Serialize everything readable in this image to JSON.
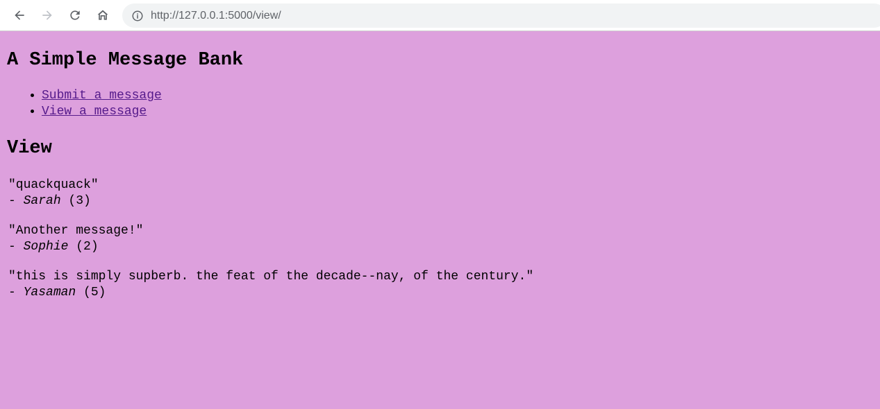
{
  "browser": {
    "url_host": "http://127.0.0.1",
    "url_rest": ":5000/view/"
  },
  "page": {
    "title": "A Simple Message Bank",
    "nav_links": [
      {
        "label": "Submit a message"
      },
      {
        "label": "View a message"
      }
    ],
    "section_heading": "View",
    "messages": [
      {
        "text": "\"quackquack\"",
        "prefix": "- ",
        "author": "Sarah",
        "count": " (3)"
      },
      {
        "text": "\"Another message!\"",
        "prefix": "- ",
        "author": "Sophie",
        "count": " (2)"
      },
      {
        "text": "\"this is simply supberb. the feat of the decade--nay, of the century.\"",
        "prefix": "- ",
        "author": "Yasaman",
        "count": " (5)"
      }
    ]
  },
  "colors": {
    "background": "#dda0dd",
    "link": "#551a8b"
  },
  "icons": [
    "back-arrow-icon",
    "forward-arrow-icon",
    "reload-icon",
    "home-icon",
    "info-icon"
  ]
}
